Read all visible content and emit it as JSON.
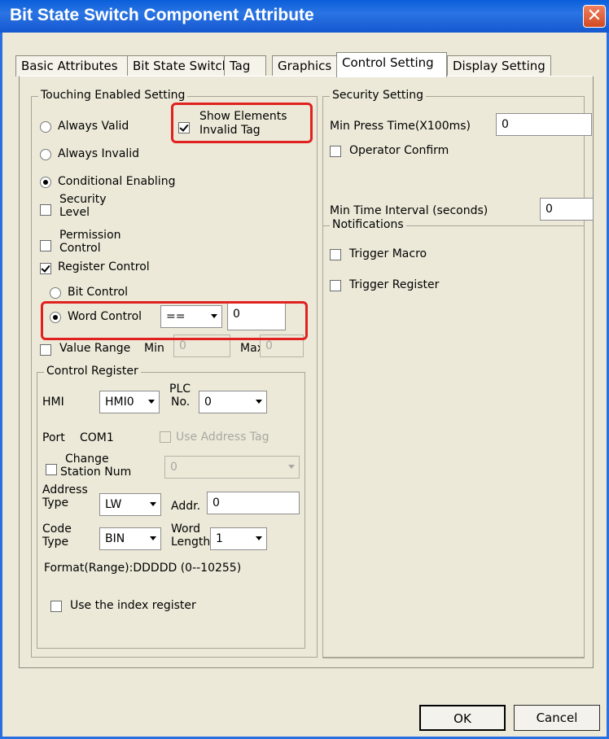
{
  "window": {
    "title": "Bit State Switch Component Attribute",
    "close_label": "✕"
  },
  "tabs": [
    {
      "label": "Basic Attributes"
    },
    {
      "label": "Bit State Switch"
    },
    {
      "label": "Tag"
    },
    {
      "label": "Graphics"
    },
    {
      "label": "Control Setting",
      "active": true
    },
    {
      "label": "Display Setting"
    }
  ],
  "touch": {
    "group_title": "Touching Enabled Setting",
    "always_valid": "Always Valid",
    "show_elements": [
      "Show Elements",
      "Invalid Tag"
    ],
    "always_invalid": "Always Invalid",
    "conditional": "Conditional Enabling",
    "security_level": [
      "Security",
      "Level"
    ],
    "permission_control": [
      "Permission",
      "Control"
    ],
    "register_control": "Register Control",
    "bit_control": "Bit Control",
    "word_control": "Word Control",
    "operator": "==",
    "word_value": "0",
    "value_range": "Value Range",
    "min_label": "Min",
    "min_value": "0",
    "max_label": "Max",
    "max_value": "0"
  },
  "control_register": {
    "group_title": "Control Register",
    "hmi_label": "HMI",
    "hmi_value": "HMI0",
    "plc_no_label": [
      "PLC",
      "No."
    ],
    "plc_no_value": "0",
    "port_label": "Port",
    "port_value": "COM1",
    "use_address_tag": "Use Address Tag",
    "change_station": [
      "Change",
      "Station Num"
    ],
    "station_value": "0",
    "address_type_label": [
      "Address",
      "Type"
    ],
    "address_type_value": "LW",
    "addr_label": "Addr.",
    "addr_value": "0",
    "code_type_label": [
      "Code",
      "Type"
    ],
    "code_type_value": "BIN",
    "word_length_label": [
      "Word",
      "Length"
    ],
    "word_length_value": "1",
    "format_range": "Format(Range):DDDDD (0--10255)",
    "use_index_register": "Use the index register"
  },
  "security": {
    "group_title": "Security Setting",
    "min_press_label": "Min Press Time(X100ms)",
    "min_press_value": "0",
    "operator_confirm": "Operator Confirm",
    "min_interval_label": "Min Time Interval (seconds)",
    "min_interval_value": "0"
  },
  "notifications": {
    "group_title": "Notifications",
    "trigger_macro": "Trigger Macro",
    "trigger_register": "Trigger Register"
  },
  "buttons": {
    "ok": "OK",
    "cancel": "Cancel"
  },
  "colors": {
    "title_bar": "#1558cf",
    "highlight": "#e0211f",
    "panel": "#ece9d8"
  }
}
